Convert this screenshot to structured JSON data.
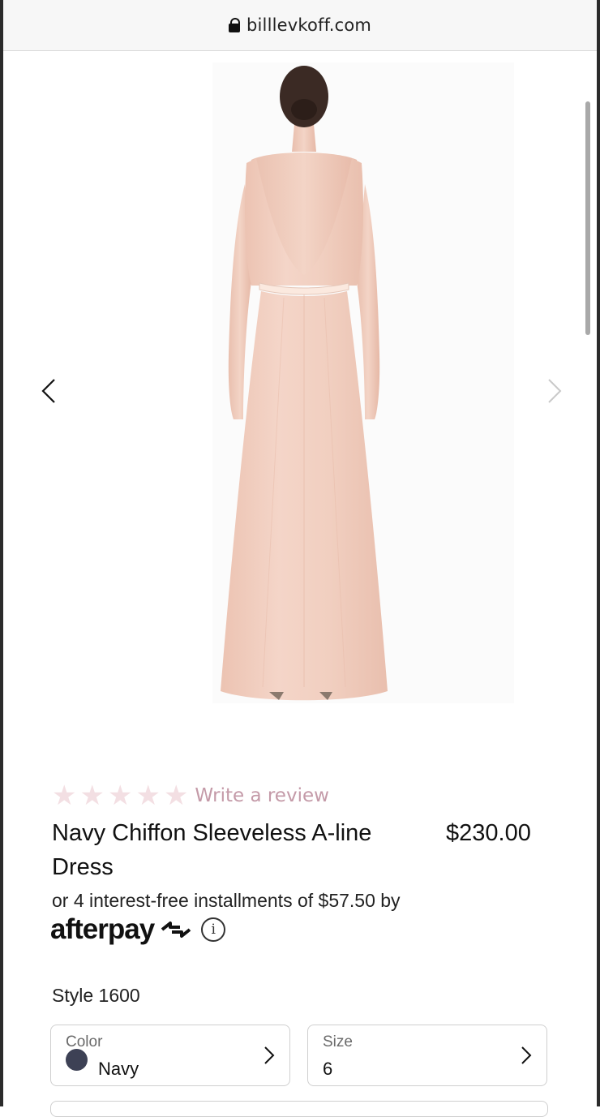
{
  "browser": {
    "url": "billlevkoff.com"
  },
  "gallery": {
    "image_alt": "Back view of floor-length blush chiffon sleeveless A-line dress"
  },
  "product": {
    "rating_stars": 0,
    "rating_max": 5,
    "review_link": "Write a review",
    "title": "Navy Chiffon Sleeveless A-line Dress",
    "price": "$230.00",
    "installments_text": "or 4 interest-free installments of $57.50 by",
    "afterpay_logo": "afterpay",
    "style": "Style 1600"
  },
  "options": {
    "color": {
      "label": "Color",
      "value": "Navy",
      "swatch_color": "#3d4155"
    },
    "size": {
      "label": "Size",
      "value": "6"
    }
  },
  "colors": {
    "star_empty": "#f3dfe3",
    "review_link": "#c49aa8",
    "dress": "#f2cdbd"
  }
}
